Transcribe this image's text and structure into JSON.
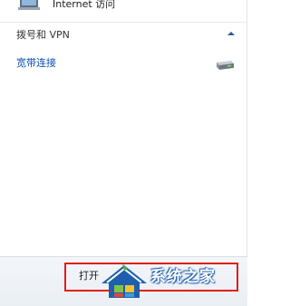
{
  "top_item": {
    "label": "Internet 访问",
    "icon": "network-connection-icon"
  },
  "section": {
    "title": "拨号和 VPN",
    "toggle_icon": "chevron-up-icon"
  },
  "connections": [
    {
      "label": "宽带连接",
      "icon": "broadband-modem-icon"
    }
  ],
  "footer": {
    "open_label": "打开"
  },
  "watermark": {
    "text": "系统之家",
    "logo": "house-logo-icon"
  },
  "colors": {
    "link": "#0b4fb3",
    "highlight_border": "#e21c1c",
    "watermark_blue": "#1f5fae"
  }
}
